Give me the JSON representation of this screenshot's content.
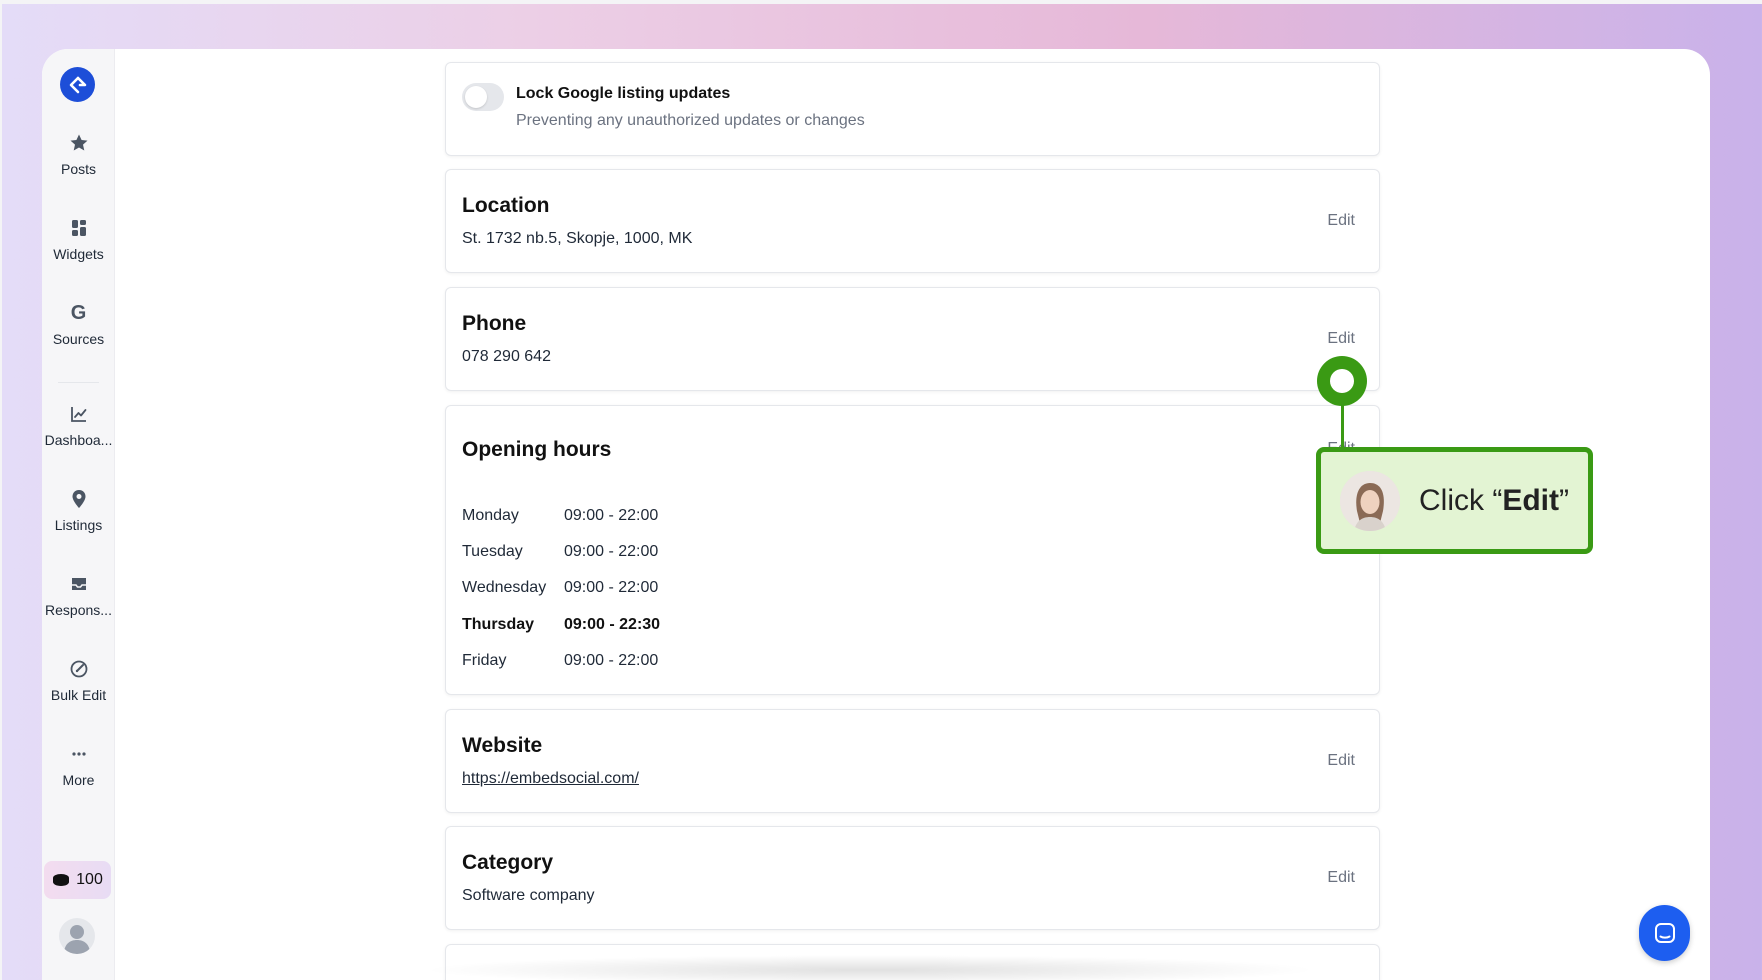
{
  "sidebar": {
    "items": [
      {
        "label": "Posts",
        "icon": "star-icon"
      },
      {
        "label": "Widgets",
        "icon": "widgets-icon"
      },
      {
        "label": "Sources",
        "icon": "google-icon"
      },
      {
        "label": "Dashboa...",
        "icon": "chart-icon"
      },
      {
        "label": "Listings",
        "icon": "location-pin-icon"
      },
      {
        "label": "Respons...",
        "icon": "inbox-icon"
      },
      {
        "label": "Bulk Edit",
        "icon": "edit-circle-icon"
      },
      {
        "label": "More",
        "icon": "more-icon"
      }
    ],
    "credits": "100"
  },
  "lock": {
    "title": "Lock Google listing updates",
    "description": "Preventing any unauthorized updates or changes",
    "enabled": false
  },
  "location": {
    "title": "Location",
    "value": "St. 1732 nb.5, Skopje, 1000, MK",
    "edit_label": "Edit"
  },
  "phone": {
    "title": "Phone",
    "value": "078 290 642",
    "edit_label": "Edit"
  },
  "opening_hours": {
    "title": "Opening hours",
    "edit_label": "Edit",
    "days": [
      {
        "day": "Monday",
        "hours": "09:00 - 22:00"
      },
      {
        "day": "Tuesday",
        "hours": "09:00 - 22:00"
      },
      {
        "day": "Wednesday",
        "hours": "09:00 - 22:00"
      },
      {
        "day": "Thursday",
        "hours": "09:00 - 22:30"
      },
      {
        "day": "Friday",
        "hours": "09:00 - 22:00"
      }
    ]
  },
  "website": {
    "title": "Website",
    "value": "https://embedsocial.com/",
    "edit_label": "Edit"
  },
  "category": {
    "title": "Category",
    "value": "Software company",
    "edit_label": "Edit"
  },
  "callout": {
    "prefix": "Click “",
    "bold": "Edit",
    "suffix": "”"
  },
  "colors": {
    "accent": "#1d4ed8",
    "callout_green": "#3a9a14",
    "callout_bg": "#e3f4d3",
    "chat": "#1d5ef0"
  }
}
